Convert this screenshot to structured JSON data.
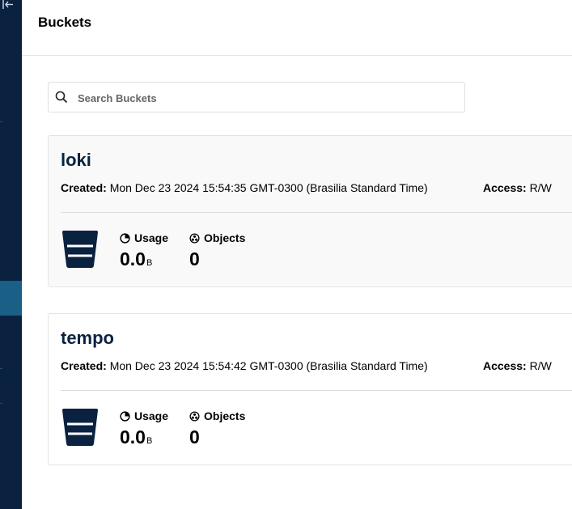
{
  "page": {
    "title": "Buckets"
  },
  "search": {
    "placeholder": "Search Buckets",
    "value": ""
  },
  "buckets": [
    {
      "name": "loki",
      "created_label": "Created:",
      "created_value": "Mon Dec 23 2024 15:54:35 GMT-0300 (Brasilia Standard Time)",
      "access_label": "Access:",
      "access_value": "R/W",
      "usage_label": "Usage",
      "usage_value": "0.0",
      "usage_unit": "B",
      "objects_label": "Objects",
      "objects_value": "0"
    },
    {
      "name": "tempo",
      "created_label": "Created:",
      "created_value": "Mon Dec 23 2024 15:54:42 GMT-0300 (Brasilia Standard Time)",
      "access_label": "Access:",
      "access_value": "R/W",
      "usage_label": "Usage",
      "usage_value": "0.0",
      "usage_unit": "B",
      "objects_label": "Objects",
      "objects_value": "0"
    }
  ],
  "colors": {
    "sidebar": "#0a2240",
    "sidebar_active": "#1a5f86",
    "bucket_name": "#0a2240"
  }
}
